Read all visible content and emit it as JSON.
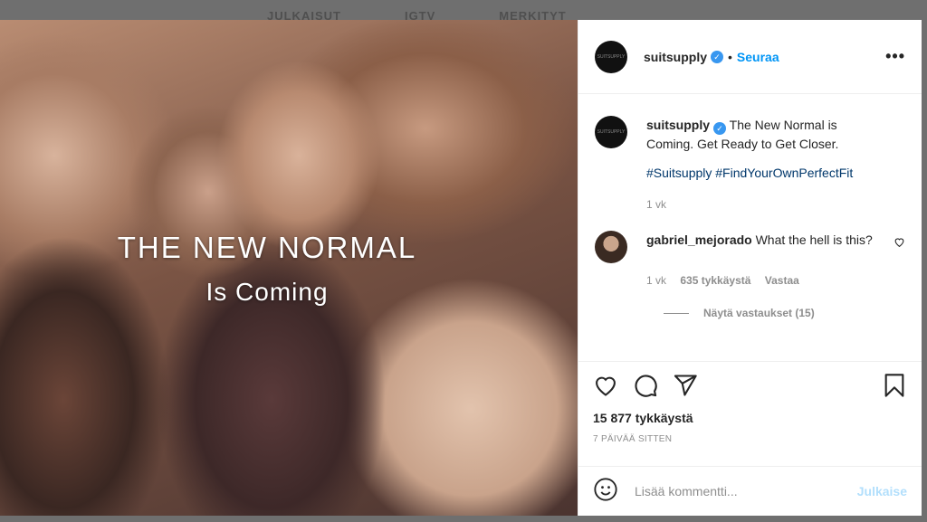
{
  "background_tabs": [
    "JULKAISUT",
    "IGTV",
    "MERKITYT"
  ],
  "photo": {
    "overlay_title": "THE NEW NORMAL",
    "overlay_subtitle": "Is Coming"
  },
  "header": {
    "username": "suitsupply",
    "avatar_text": "SUITSUPPLY",
    "separator": "•",
    "follow_label": "Seuraa",
    "more_label": "•••"
  },
  "caption": {
    "username": "suitsupply",
    "text": "The New Normal is Coming. Get Ready to Get Closer.",
    "hashtags": "#Suitsupply #FindYourOwnPerfectFit",
    "age": "1 vk"
  },
  "comment": {
    "username": "gabriel_mejorado",
    "text": "What the hell is this?",
    "age": "1 vk",
    "likes": "635 tykkäystä",
    "reply_label": "Vastaa",
    "view_replies": "Näytä vastaukset (15)"
  },
  "actions": {
    "likes": "15 877 tykkäystä",
    "date": "7 PÄIVÄÄ SITTEN"
  },
  "add_comment": {
    "placeholder": "Lisää kommentti...",
    "publish_label": "Julkaise"
  },
  "colors": {
    "link": "#0095f6",
    "hashtag": "#00376b",
    "muted": "#8e8e8e",
    "publish_disabled": "#b2dffc"
  }
}
